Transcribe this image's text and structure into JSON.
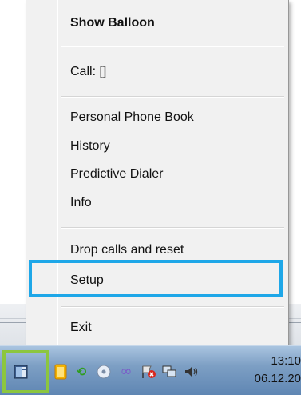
{
  "menu": {
    "items": [
      {
        "label": "Show Balloon",
        "bold": true
      },
      {
        "label": "Call: []"
      },
      {
        "label": "Personal Phone Book"
      },
      {
        "label": "History"
      },
      {
        "label": "Predictive Dialer"
      },
      {
        "label": "Info"
      },
      {
        "label": "Drop calls and reset"
      },
      {
        "label": "Setup",
        "highlighted": true
      },
      {
        "label": "Exit"
      }
    ]
  },
  "taskbar": {
    "clock_time": "13:10",
    "clock_date": "06.12.20",
    "tray_icons": [
      "phone-app-icon",
      "folder-icon",
      "sync-arrows-icon",
      "disc-icon",
      "infinity-icon",
      "flag-error-icon",
      "network-icon",
      "volume-icon"
    ]
  },
  "colors": {
    "highlight_border": "#1ea7e8",
    "tray_highlight": "#8cc63f",
    "taskbar": "#6f93bd"
  }
}
